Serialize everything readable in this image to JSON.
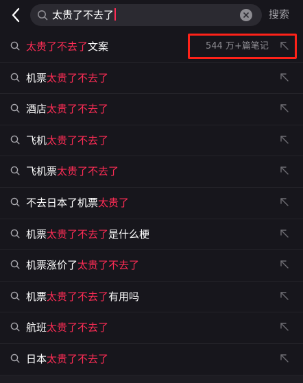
{
  "search": {
    "query": "太贵了不去了",
    "submit_label": "搜索"
  },
  "colors": {
    "background": "#17161c",
    "highlight": "#fe2c55",
    "annotation_box": "#ff2219"
  },
  "icons": {
    "back": "chevron-left-icon",
    "search": "search-icon",
    "clear": "clear-icon",
    "fill": "arrow-up-left-icon"
  },
  "suggestions": [
    {
      "pre": "",
      "hl": "太贵了不去了",
      "post": "文案",
      "count": "544 万+篇笔记"
    },
    {
      "pre": "机票",
      "hl": "太贵了不去了",
      "post": ""
    },
    {
      "pre": "酒店",
      "hl": "太贵了不去了",
      "post": ""
    },
    {
      "pre": "飞机",
      "hl": "太贵了不去了",
      "post": ""
    },
    {
      "pre": "飞机票",
      "hl": "太贵了不去了",
      "post": ""
    },
    {
      "pre": "不去日本了机票",
      "hl": "太贵了",
      "post": ""
    },
    {
      "pre": "机票",
      "hl": "太贵了不去了",
      "post": "是什么梗"
    },
    {
      "pre": "机票涨价了",
      "hl": "太贵了不去了",
      "post": ""
    },
    {
      "pre": "机票",
      "hl": "太贵了不去了",
      "post": "有用吗"
    },
    {
      "pre": "航班",
      "hl": "太贵了不去了",
      "post": ""
    },
    {
      "pre": "日本",
      "hl": "太贵了不去了",
      "post": ""
    }
  ]
}
